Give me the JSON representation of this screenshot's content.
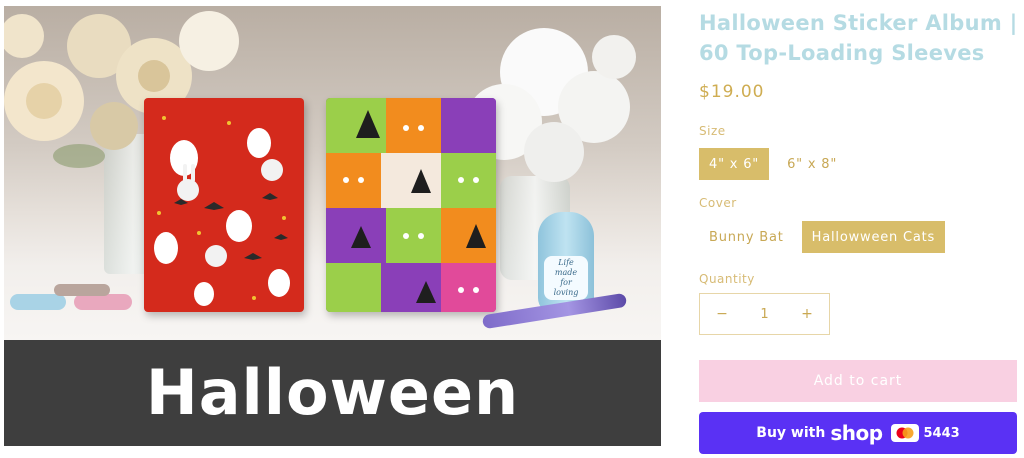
{
  "product_image": {
    "banner_text": "Halloween",
    "figurine_text": "Life\nmade\nfor\nloving"
  },
  "product": {
    "title": "Halloween Sticker Album | 60 Top-Loading Sleeves",
    "price": "$19.00"
  },
  "options": {
    "size": {
      "label": "Size",
      "values": [
        "4\" x 6\"",
        "6\" x 8\""
      ],
      "selected": "4\" x 6\""
    },
    "cover": {
      "label": "Cover",
      "values": [
        "Bunny Bat",
        "Hallowween Cats"
      ],
      "selected": "Hallowween Cats"
    }
  },
  "quantity": {
    "label": "Quantity",
    "value": "1",
    "minus": "−",
    "plus": "+"
  },
  "buttons": {
    "add_to_cart": "Add to cart",
    "buy_with": "Buy with",
    "shop_logo": "shop",
    "card_digits": "5443"
  },
  "colors": {
    "title": "#b5dbe3",
    "accent_gold": "#d8bd6a",
    "add_to_cart_bg": "#f9d0e2",
    "shop_pay_bg": "#5a31f4",
    "banner_bg": "#3e3e3e"
  }
}
